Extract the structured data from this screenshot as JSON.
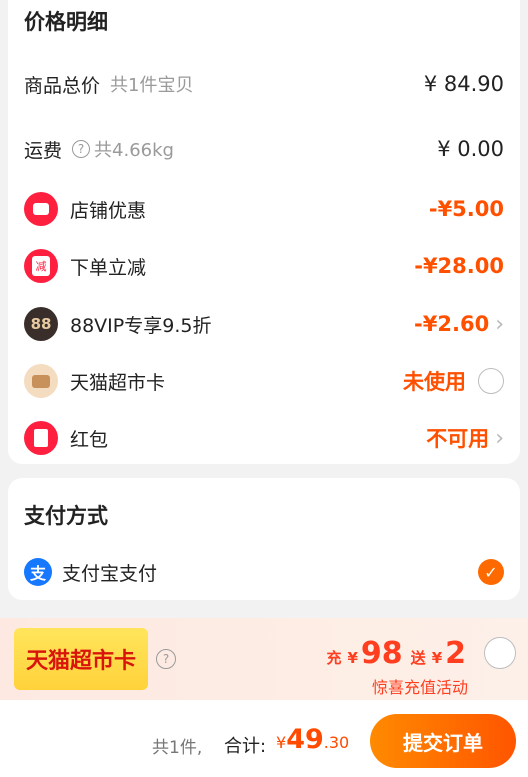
{
  "price_detail": {
    "title": "价格明细",
    "goods_total": {
      "label": "商品总价",
      "sub": "共1件宝贝",
      "value": "¥ 84.90"
    },
    "shipping": {
      "label": "运费",
      "sub": "共4.66kg",
      "value": "¥ 0.00",
      "icon": "question-icon"
    },
    "shop_discount": {
      "label": "店铺优惠",
      "value": "-¥5.00",
      "icon": "ticket-icon"
    },
    "order_reduction": {
      "label": "下单立减",
      "value": "-¥28.00",
      "icon": "reduce-icon",
      "icon_text": "减"
    },
    "vip": {
      "label": "88VIP专享9.5折",
      "value": "-¥2.60",
      "icon": "88vip-icon",
      "icon_text": "88"
    },
    "tmall_card": {
      "label": "天猫超市卡",
      "value": "未使用",
      "icon": "card-icon"
    },
    "red_packet": {
      "label": "红包",
      "value": "不可用",
      "icon": "red-packet-icon"
    }
  },
  "payment": {
    "title": "支付方式",
    "method": {
      "label": "支付宝支付",
      "icon": "alipay-icon",
      "icon_text": "支",
      "selected": true
    }
  },
  "promo": {
    "badge": "天猫超市卡",
    "recharge_prefix": "充",
    "currency": "¥",
    "recharge_amount": "98",
    "gift_prefix": "送",
    "gift_amount": "2",
    "note": "惊喜充值活动"
  },
  "footer": {
    "count": "共1件,",
    "total_label": "合计:",
    "currency": "¥",
    "total_int": "49",
    "total_dec": ".30",
    "submit_label": "提交订单"
  },
  "colors": {
    "accent_orange": "#ff5000",
    "discount_red": "#ff1f3f",
    "alipay_blue": "#1677ff"
  }
}
